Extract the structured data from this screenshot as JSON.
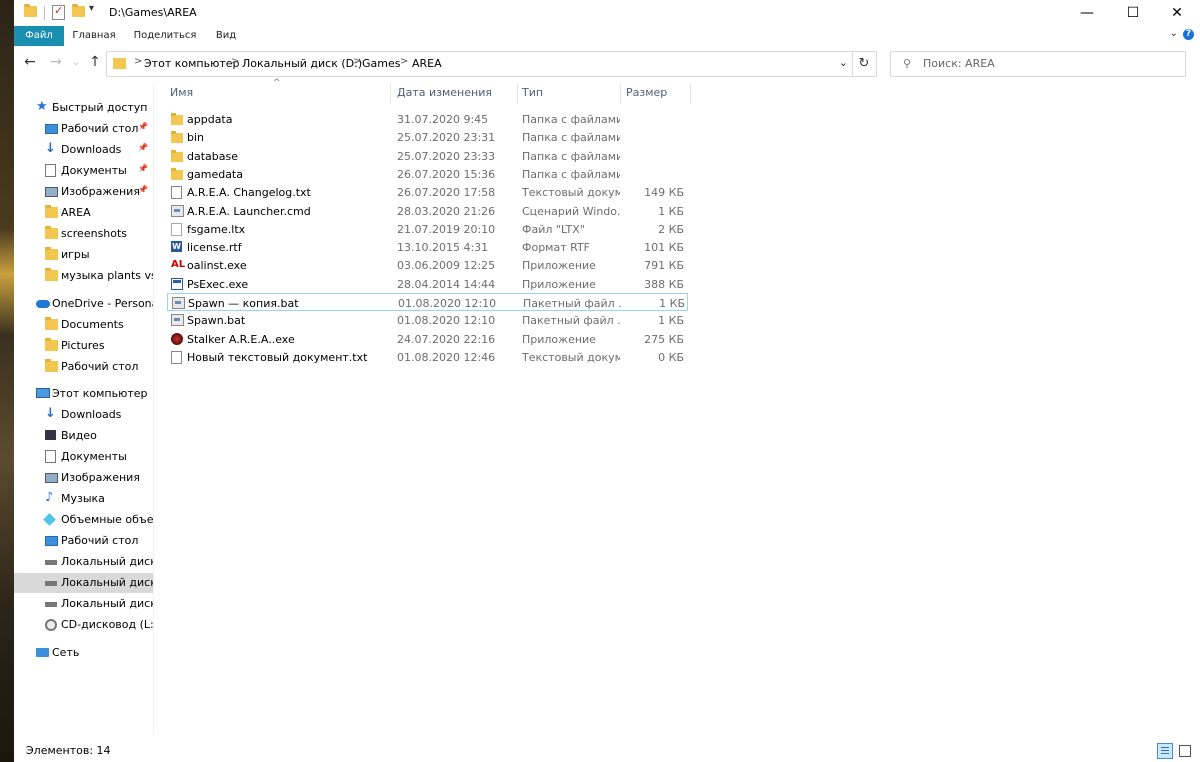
{
  "window": {
    "title": "D:\\Games\\AREA",
    "controls": {
      "minimize": "—",
      "maximize": "☐",
      "close": "✕"
    }
  },
  "ribbon": {
    "tabs": [
      "Файл",
      "Главная",
      "Поделиться",
      "Вид"
    ],
    "active_tab": "Файл",
    "accent_color": "#1b8fb1"
  },
  "address": {
    "breadcrumbs": [
      "Этот компьютер",
      "Локальный диск (D:)",
      "Games",
      "AREA"
    ],
    "separator": ">"
  },
  "search": {
    "placeholder": "Поиск: AREA"
  },
  "nav_pane": [
    {
      "label": "Быстрый доступ",
      "icon": "star-icon",
      "pinned": false,
      "selected": false
    },
    {
      "label": "Рабочий стол",
      "icon": "desktop-icon",
      "pinned": true,
      "selected": false
    },
    {
      "label": "Downloads",
      "icon": "download-icon",
      "pinned": true,
      "selected": false
    },
    {
      "label": "Документы",
      "icon": "document-icon",
      "pinned": true,
      "selected": false
    },
    {
      "label": "Изображения",
      "icon": "image-icon",
      "pinned": true,
      "selected": false
    },
    {
      "label": "AREA",
      "icon": "folder-icon",
      "pinned": false,
      "selected": false
    },
    {
      "label": "screenshots",
      "icon": "folder-icon",
      "pinned": false,
      "selected": false
    },
    {
      "label": "игры",
      "icon": "folder-icon",
      "pinned": false,
      "selected": false
    },
    {
      "label": "музыка plants vs zc",
      "icon": "folder-icon",
      "pinned": false,
      "selected": false
    },
    {
      "label": "OneDrive - Personal",
      "icon": "cloud-icon",
      "pinned": false,
      "selected": false
    },
    {
      "label": "Documents",
      "icon": "folder-icon",
      "pinned": false,
      "selected": false
    },
    {
      "label": "Pictures",
      "icon": "folder-icon",
      "pinned": false,
      "selected": false
    },
    {
      "label": "Рабочий стол",
      "icon": "folder-icon",
      "pinned": false,
      "selected": false
    },
    {
      "label": "Этот компьютер",
      "icon": "computer-icon",
      "pinned": false,
      "selected": false
    },
    {
      "label": "Downloads",
      "icon": "download-icon",
      "pinned": false,
      "selected": false
    },
    {
      "label": "Видео",
      "icon": "video-icon",
      "pinned": false,
      "selected": false
    },
    {
      "label": "Документы",
      "icon": "document-icon",
      "pinned": false,
      "selected": false
    },
    {
      "label": "Изображения",
      "icon": "image-icon",
      "pinned": false,
      "selected": false
    },
    {
      "label": "Музыка",
      "icon": "music-icon",
      "pinned": false,
      "selected": false
    },
    {
      "label": "Объемные объекты",
      "icon": "3d-objects-icon",
      "pinned": false,
      "selected": false
    },
    {
      "label": "Рабочий стол",
      "icon": "desktop-icon",
      "pinned": false,
      "selected": false
    },
    {
      "label": "Локальный диск (C",
      "icon": "drive-icon",
      "pinned": false,
      "selected": false
    },
    {
      "label": "Локальный диск (D",
      "icon": "drive-icon",
      "pinned": false,
      "selected": true
    },
    {
      "label": "Локальный диск (E",
      "icon": "drive-icon",
      "pinned": false,
      "selected": false
    },
    {
      "label": "CD-дисковод (L:)",
      "icon": "cd-drive-icon",
      "pinned": false,
      "selected": false
    },
    {
      "label": "Сеть",
      "icon": "network-icon",
      "pinned": false,
      "selected": false
    }
  ],
  "columns": {
    "name": "Имя",
    "date": "Дата изменения",
    "type": "Тип",
    "size": "Размер"
  },
  "files": [
    {
      "name": "appdata",
      "date": "31.07.2020 9:45",
      "type": "Папка с файлами",
      "size": "",
      "icon": "folder-icon"
    },
    {
      "name": "bin",
      "date": "25.07.2020 23:31",
      "type": "Папка с файлами",
      "size": "",
      "icon": "folder-icon"
    },
    {
      "name": "database",
      "date": "25.07.2020 23:33",
      "type": "Папка с файлами",
      "size": "",
      "icon": "folder-icon"
    },
    {
      "name": "gamedata",
      "date": "26.07.2020 15:36",
      "type": "Папка с файлами",
      "size": "",
      "icon": "folder-icon"
    },
    {
      "name": "A.R.E.A. Changelog.txt",
      "date": "26.07.2020 17:58",
      "type": "Текстовый докум...",
      "size": "149 КБ",
      "icon": "text-file-icon"
    },
    {
      "name": "A.R.E.A. Launcher.cmd",
      "date": "28.03.2020 21:26",
      "type": "Сценарий Windo...",
      "size": "1 КБ",
      "icon": "script-file-icon"
    },
    {
      "name": "fsgame.ltx",
      "date": "21.07.2019 20:10",
      "type": "Файл \"LTX\"",
      "size": "2 КБ",
      "icon": "blank-file-icon"
    },
    {
      "name": "license.rtf",
      "date": "13.10.2015 4:31",
      "type": "Формат RTF",
      "size": "101 КБ",
      "icon": "word-file-icon"
    },
    {
      "name": "oalinst.exe",
      "date": "03.06.2009 12:25",
      "type": "Приложение",
      "size": "791 КБ",
      "icon": "openal-app-icon"
    },
    {
      "name": "PsExec.exe",
      "date": "28.04.2014 14:44",
      "type": "Приложение",
      "size": "388 КБ",
      "icon": "app-window-icon"
    },
    {
      "name": "Spawn — копия.bat",
      "date": "01.08.2020 12:10",
      "type": "Пакетный файл ...",
      "size": "1 КБ",
      "icon": "script-file-icon",
      "focused": true
    },
    {
      "name": "Spawn.bat",
      "date": "01.08.2020 12:10",
      "type": "Пакетный файл ...",
      "size": "1 КБ",
      "icon": "script-file-icon"
    },
    {
      "name": "Stalker A.R.E.A..exe",
      "date": "24.07.2020 22:16",
      "type": "Приложение",
      "size": "275 КБ",
      "icon": "stalker-app-icon"
    },
    {
      "name": "Новый текстовый документ.txt",
      "date": "01.08.2020 12:46",
      "type": "Текстовый докум...",
      "size": "0 КБ",
      "icon": "text-file-icon"
    }
  ],
  "status": {
    "item_count": "Элементов: 14"
  }
}
